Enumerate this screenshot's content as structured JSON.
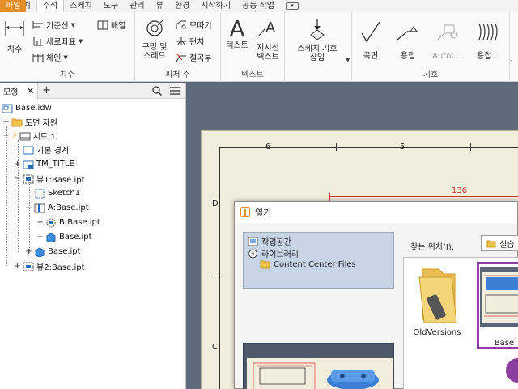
{
  "tabs": [
    {
      "label": "파일"
    },
    {
      "label": "뷰 배치"
    },
    {
      "label": "주석"
    },
    {
      "label": "스케치"
    },
    {
      "label": "도구"
    },
    {
      "label": "관리"
    },
    {
      "label": "뷰"
    },
    {
      "label": "환경"
    },
    {
      "label": "시작하기"
    },
    {
      "label": "공동 작업"
    }
  ],
  "ribbon": {
    "dimension": {
      "label": "치수",
      "big": "치수",
      "baseline": "기준선",
      "ordinate": "세로좌표",
      "chain": "체인",
      "arrange": "배열"
    },
    "feature_notes": {
      "label": "피처 주",
      "hole_thread_1": "구멍 및",
      "hole_thread_2": "스레드",
      "chamfer": "모따기",
      "punch": "펀치",
      "bend": "절곡부"
    },
    "text": {
      "label": "텍스트",
      "text": "텍스트",
      "leader_1": "지시선",
      "leader_2": "텍스트"
    },
    "sketch_symbols": {
      "insert_1": "스케치 기호",
      "insert_2": "삽입"
    },
    "symbols": {
      "label": "기호",
      "surface": "곡면",
      "weld": "용접",
      "autocad": "AutoC...",
      "weld2": "용접..."
    }
  },
  "browser": {
    "tab": "모형",
    "nodes": [
      {
        "label": "Base.idw"
      },
      {
        "label": "도면 자원"
      },
      {
        "label": "시트:1"
      },
      {
        "label": "기본 경계"
      },
      {
        "label": "TM_TITLE"
      },
      {
        "label": "뷰1:Base.ipt"
      },
      {
        "label": "Sketch1"
      },
      {
        "label": "A:Base.ipt"
      },
      {
        "label": "B:Base.ipt"
      },
      {
        "label": "Base.ipt"
      },
      {
        "label": "Base.ipt"
      },
      {
        "label": "뷰2:Base.ipt"
      }
    ]
  },
  "drawing": {
    "zone_top_6": "6",
    "zone_top_5": "5",
    "zone_left_d": "D",
    "zone_left_c": "C",
    "dim_value": "136"
  },
  "dialog": {
    "title": "열기",
    "places": [
      "작업공간",
      "라이브러리",
      "Content Center Files"
    ],
    "lookin_label": "찾는 위치(I):",
    "lookin_value": "실습",
    "files": [
      {
        "label": "OldVersions"
      },
      {
        "label": "Base"
      }
    ]
  },
  "colors": {
    "file_tab": "#e58f2a",
    "canvas": "#5e6a7c",
    "sheet": "#f2eedd",
    "places_bg": "#c6d4e6",
    "selected_file": "#8b3fa0",
    "dim_red": "#d33030"
  }
}
